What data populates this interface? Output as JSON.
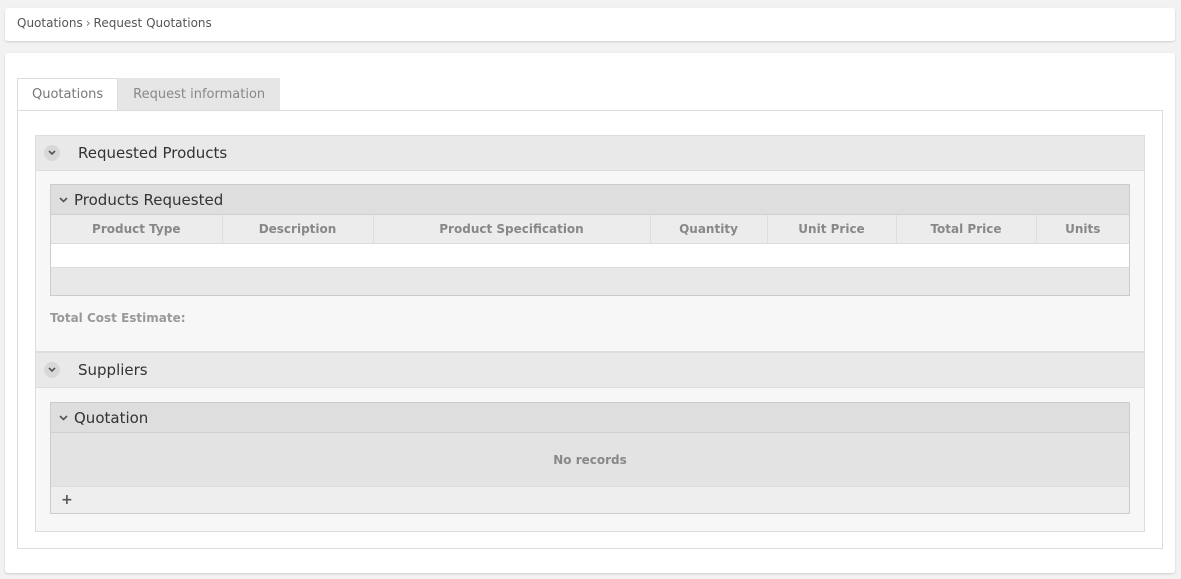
{
  "breadcrumb": {
    "parent": "Quotations",
    "separator": "›",
    "current": "Request Quotations"
  },
  "tabs": [
    {
      "label": "Quotations",
      "active": true
    },
    {
      "label": "Request information",
      "active": false
    }
  ],
  "requested_products": {
    "title": "Requested Products",
    "toggle_icon": "chevron-down-icon",
    "grid": {
      "title": "Products Requested",
      "columns": [
        "Product Type",
        "Description",
        "Product Specification",
        "Quantity",
        "Unit Price",
        "Total Price",
        "Units"
      ],
      "rows": []
    },
    "total_label": "Total Cost Estimate:"
  },
  "suppliers": {
    "title": "Suppliers",
    "toggle_icon": "chevron-down-icon",
    "grid": {
      "title": "Quotation",
      "empty_text": "No records",
      "add_icon": "+"
    }
  }
}
